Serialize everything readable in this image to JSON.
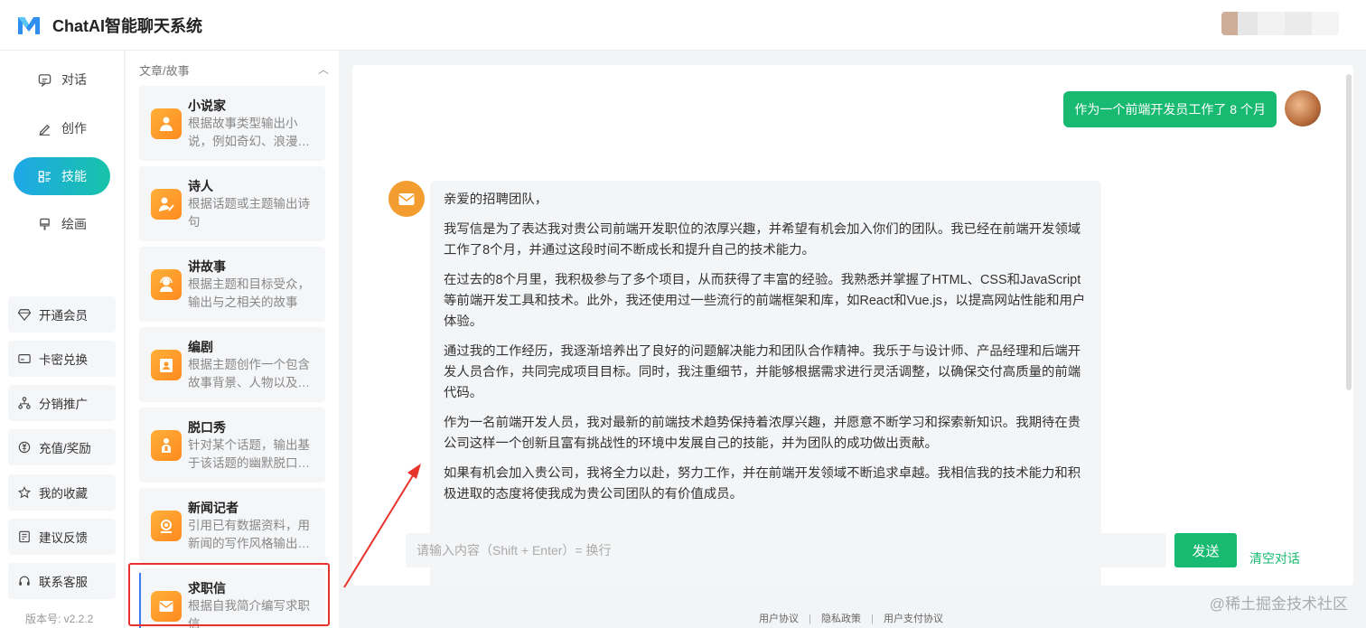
{
  "app": {
    "title": "ChatAI智能聊天系统"
  },
  "nav": {
    "items": [
      {
        "label": "对话",
        "icon": "chat-icon"
      },
      {
        "label": "创作",
        "icon": "pen-icon"
      },
      {
        "label": "技能",
        "icon": "skills-icon",
        "active": true
      },
      {
        "label": "绘画",
        "icon": "brush-icon"
      }
    ],
    "utils": [
      {
        "label": "开通会员",
        "icon": "diamond-icon"
      },
      {
        "label": "卡密兑换",
        "icon": "card-icon"
      },
      {
        "label": "分销推广",
        "icon": "share-icon"
      },
      {
        "label": "充值/奖励",
        "icon": "recharge-icon"
      },
      {
        "label": "我的收藏",
        "icon": "star-icon"
      },
      {
        "label": "建议反馈",
        "icon": "feedback-icon"
      },
      {
        "label": "联系客服",
        "icon": "headset-icon"
      }
    ],
    "version": "版本号: v2.2.2"
  },
  "skills": {
    "category": "文章/故事",
    "cards": [
      {
        "name": "小说家",
        "desc": "根据故事类型输出小说，例如奇幻、浪漫…"
      },
      {
        "name": "诗人",
        "desc": "根据话题或主题输出诗句"
      },
      {
        "name": "讲故事",
        "desc": "根据主题和目标受众，输出与之相关的故事"
      },
      {
        "name": "编剧",
        "desc": "根据主题创作一个包含故事背景、人物以及…"
      },
      {
        "name": "脱口秀",
        "desc": "针对某个话题，输出基于该话题的幽默脱口…"
      },
      {
        "name": "新闻记者",
        "desc": "引用已有数据资料，用新闻的写作风格输出…"
      },
      {
        "name": "求职信",
        "desc": "根据自我简介编写求职信"
      }
    ]
  },
  "chat": {
    "user_message": "作为一个前端开发员工作了 8 个月",
    "bot_paragraphs": [
      "亲爱的招聘团队，",
      "我写信是为了表达我对贵公司前端开发职位的浓厚兴趣，并希望有机会加入你们的团队。我已经在前端开发领域工作了8个月，并通过这段时间不断成长和提升自己的技术能力。",
      "在过去的8个月里，我积极参与了多个项目，从而获得了丰富的经验。我熟悉并掌握了HTML、CSS和JavaScript等前端开发工具和技术。此外，我还使用过一些流行的前端框架和库，如React和Vue.js，以提高网站性能和用户体验。",
      "通过我的工作经历，我逐渐培养出了良好的问题解决能力和团队合作精神。我乐于与设计师、产品经理和后端开发人员合作，共同完成项目目标。同时，我注重细节，并能够根据需求进行灵活调整，以确保交付高质量的前端代码。",
      "作为一名前端开发人员，我对最新的前端技术趋势保持着浓厚兴趣，并愿意不断学习和探索新知识。我期待在贵公司这样一个创新且富有挑战性的环境中发展自己的技能，并为团队的成功做出贡献。",
      "如果有机会加入贵公司，我将全力以赴，努力工作，并在前端开发领域不断追求卓越。我相信我的技术能力和积极进取的态度将使我成为贵公司团队的有价值成员。"
    ],
    "input_placeholder": "请输入内容（Shift + Enter）= 换行",
    "send_label": "发送",
    "clear_label": "清空对话"
  },
  "footer": {
    "links": [
      "用户协议",
      "隐私政策",
      "用户支付协议"
    ],
    "separator": "|"
  },
  "watermark": "@稀土掘金技术社区",
  "colors": {
    "accent_green": "#18b970",
    "accent_blue": "#1fa7e8",
    "skill_orange": "#ff9a2a",
    "annotation_red": "#e8332c"
  }
}
